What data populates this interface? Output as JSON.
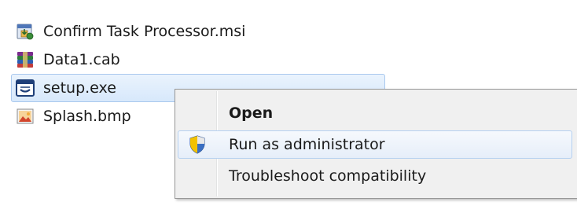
{
  "files": [
    {
      "name": "Confirm Task Processor.msi",
      "icon": "msi-installer-icon",
      "selected": false
    },
    {
      "name": "Data1.cab",
      "icon": "cab-archive-icon",
      "selected": false
    },
    {
      "name": "setup.exe",
      "icon": "exe-application-icon",
      "selected": true
    },
    {
      "name": "Splash.bmp",
      "icon": "bitmap-image-icon",
      "selected": false
    }
  ],
  "context_menu": {
    "items": [
      {
        "label": "Open",
        "bold": true,
        "icon": ""
      },
      {
        "label": "Run as administrator",
        "bold": false,
        "icon": "uac-shield-icon",
        "hovered": true
      },
      {
        "label": "Troubleshoot compatibility",
        "bold": false,
        "icon": ""
      }
    ]
  },
  "colors": {
    "selection_bg": "#d7e8fb",
    "selection_border": "#a9c8ee",
    "menu_bg": "#f0f0f0",
    "menu_border": "#979797"
  }
}
